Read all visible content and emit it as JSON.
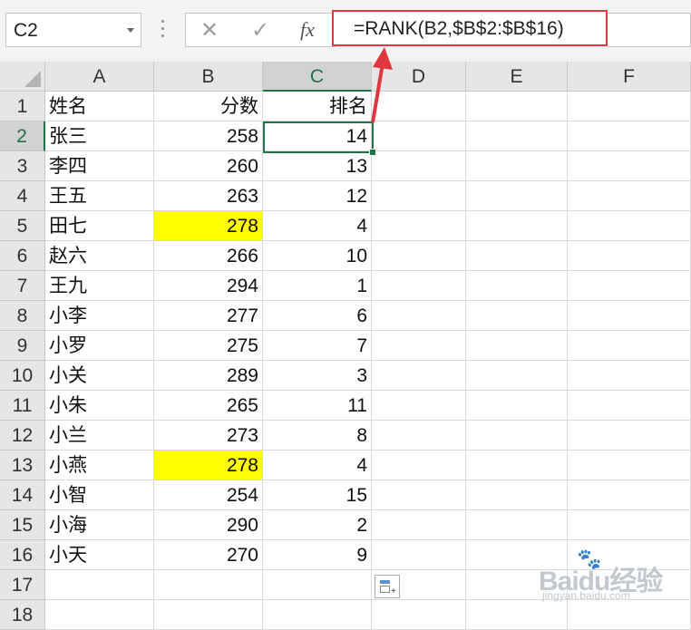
{
  "formula_bar": {
    "name_box": "C2",
    "cancel_icon": "✕",
    "enter_icon": "✓",
    "fx_label": "fx",
    "formula": "=RANK(B2,$B$2:$B$16)"
  },
  "columns": [
    "A",
    "B",
    "C",
    "D",
    "E",
    "F"
  ],
  "active_column": "C",
  "active_row": "2",
  "header_row": {
    "a": "姓名",
    "b": "分数",
    "c": "排名"
  },
  "rows": [
    {
      "num": "2",
      "name": "张三",
      "score": "258",
      "rank": "14"
    },
    {
      "num": "3",
      "name": "李四",
      "score": "260",
      "rank": "13"
    },
    {
      "num": "4",
      "name": "王五",
      "score": "263",
      "rank": "12"
    },
    {
      "num": "5",
      "name": "田七",
      "score": "278",
      "rank": "4",
      "highlight": true
    },
    {
      "num": "6",
      "name": "赵六",
      "score": "266",
      "rank": "10"
    },
    {
      "num": "7",
      "name": "王九",
      "score": "294",
      "rank": "1"
    },
    {
      "num": "8",
      "name": "小李",
      "score": "277",
      "rank": "6"
    },
    {
      "num": "9",
      "name": "小罗",
      "score": "275",
      "rank": "7"
    },
    {
      "num": "10",
      "name": "小关",
      "score": "289",
      "rank": "3"
    },
    {
      "num": "11",
      "name": "小朱",
      "score": "265",
      "rank": "11"
    },
    {
      "num": "12",
      "name": "小兰",
      "score": "273",
      "rank": "8"
    },
    {
      "num": "13",
      "name": "小燕",
      "score": "278",
      "rank": "4",
      "highlight": true
    },
    {
      "num": "14",
      "name": "小智",
      "score": "254",
      "rank": "15"
    },
    {
      "num": "15",
      "name": "小海",
      "score": "290",
      "rank": "2"
    },
    {
      "num": "16",
      "name": "小天",
      "score": "270",
      "rank": "9"
    }
  ],
  "extra_rows": [
    "1",
    "17",
    "18"
  ],
  "colors": {
    "highlight": "#ffff00",
    "selection": "#217346",
    "callout": "#e0383e"
  },
  "watermark": {
    "main": "Baidu经验",
    "sub": "jingyan.baidu.com"
  }
}
